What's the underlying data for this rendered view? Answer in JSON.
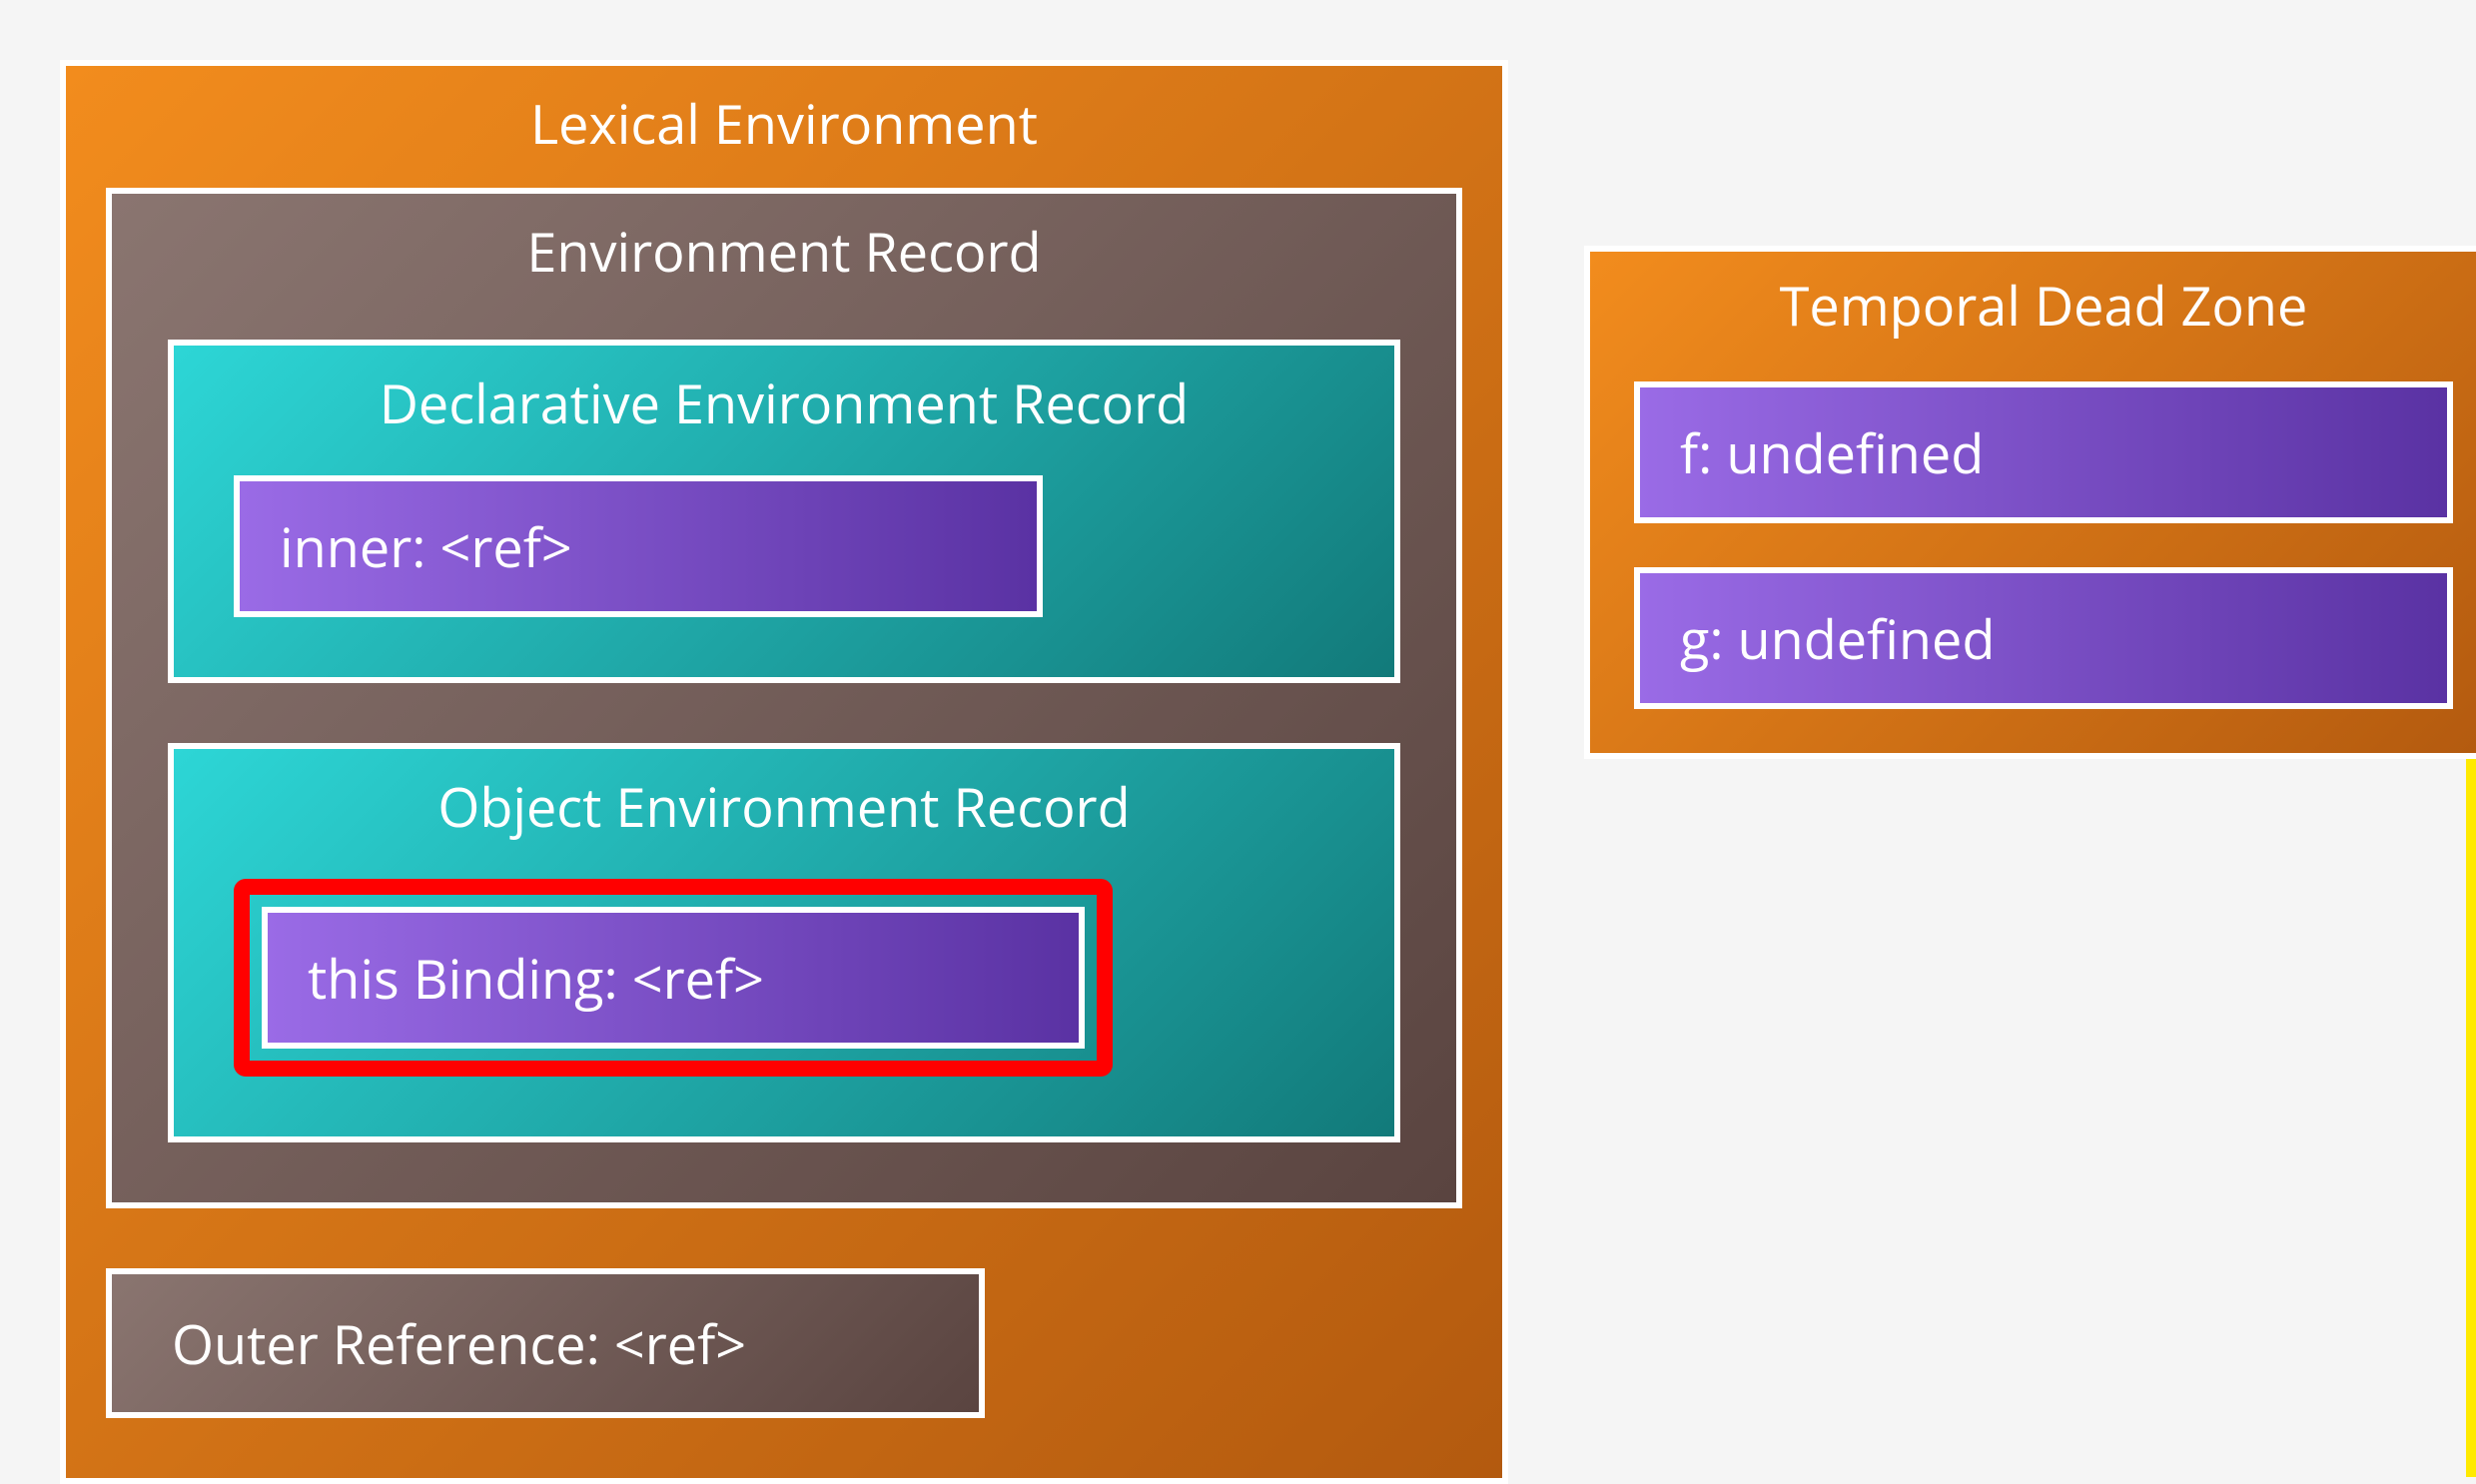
{
  "lexicalEnvironment": {
    "title": "Lexical Environment",
    "environmentRecord": {
      "title": "Environment Record",
      "declarative": {
        "title": "Declarative Environment Record",
        "entries": [
          "inner: <ref>"
        ]
      },
      "object": {
        "title": "Object Environment Record",
        "highlightedEntry": "this Binding: <ref>"
      }
    },
    "outerReference": "Outer Reference: <ref>"
  },
  "temporalDeadZone": {
    "title": "Temporal Dead Zone",
    "entries": [
      "f: undefined",
      "g: undefined"
    ]
  },
  "colors": {
    "orange_start": "#f28c1d",
    "orange_end": "#b35a0f",
    "brown_start": "#8a7570",
    "brown_end": "#5a4440",
    "teal_start": "#2dd6d6",
    "teal_end": "#127a7a",
    "purple_start": "#9a6be6",
    "purple_end": "#5a32a3",
    "highlight_border": "#ff0000",
    "white": "#ffffff"
  }
}
